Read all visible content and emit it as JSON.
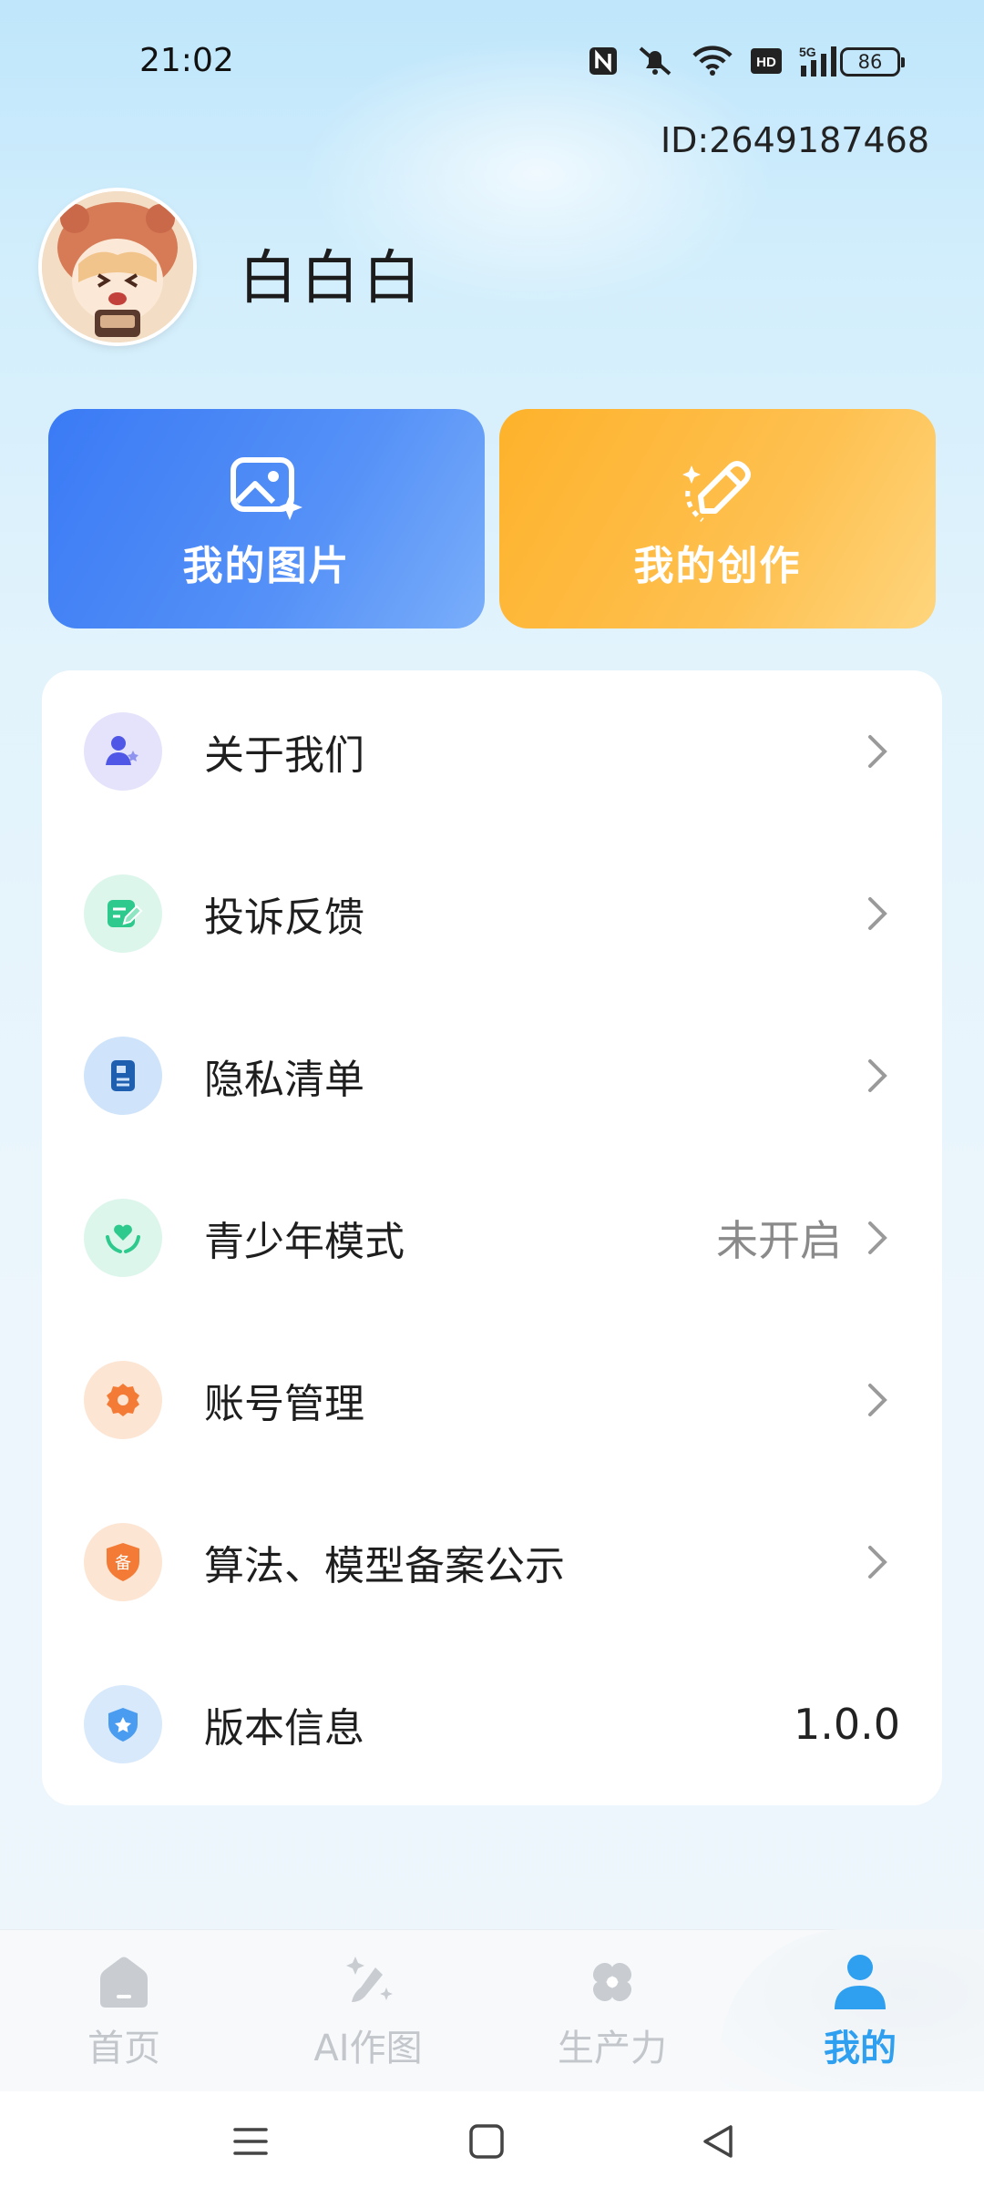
{
  "status_bar": {
    "time": "21:02",
    "battery": "86",
    "icons": [
      "nfc-icon",
      "mute-icon",
      "wifi-icon",
      "hd-icon",
      "signal-5g-icon",
      "battery-icon"
    ]
  },
  "profile": {
    "id_text": "ID:2649187468",
    "username": "白白白"
  },
  "actions": [
    {
      "label": "我的图片",
      "icon": "image-sparkle-icon",
      "color": "#3a7af5"
    },
    {
      "label": "我的创作",
      "icon": "pen-sparkle-icon",
      "color": "#feb22b"
    }
  ],
  "menu": [
    {
      "label": "关于我们",
      "value": "",
      "icon": "users-icon",
      "icon_bg": "#e4e3fb",
      "icon_color": "#5057e6"
    },
    {
      "label": "投诉反馈",
      "value": "",
      "icon": "feedback-edit-icon",
      "icon_bg": "#ddf6ec",
      "icon_color": "#2ec98c"
    },
    {
      "label": "隐私清单",
      "value": "",
      "icon": "document-icon",
      "icon_bg": "#cfe4fa",
      "icon_color": "#1f5fb0"
    },
    {
      "label": "青少年模式",
      "value": "未开启",
      "icon": "heart-hands-icon",
      "icon_bg": "#ddf6ec",
      "icon_color": "#2ec98c"
    },
    {
      "label": "账号管理",
      "value": "",
      "icon": "gear-icon",
      "icon_bg": "#fde5d3",
      "icon_color": "#f37b35"
    },
    {
      "label": "算法、模型备案公示",
      "value": "",
      "icon": "shield-badge-icon",
      "icon_bg": "#fde5d3",
      "icon_color": "#f37b35",
      "badge_text": "备"
    },
    {
      "label": "版本信息",
      "value": "1.0.0",
      "icon": "shield-star-icon",
      "icon_bg": "#d7e9fb",
      "icon_color": "#4a9cf0"
    }
  ],
  "bottom_nav": [
    {
      "label": "首页",
      "icon": "home-icon",
      "active": false
    },
    {
      "label": "AI作图",
      "icon": "ai-brush-icon",
      "active": false
    },
    {
      "label": "生产力",
      "icon": "productivity-icon",
      "active": false
    },
    {
      "label": "我的",
      "icon": "person-icon",
      "active": true
    }
  ],
  "colors": {
    "accent": "#2f9ff0",
    "inactive_nav": "#c3c6cb"
  }
}
